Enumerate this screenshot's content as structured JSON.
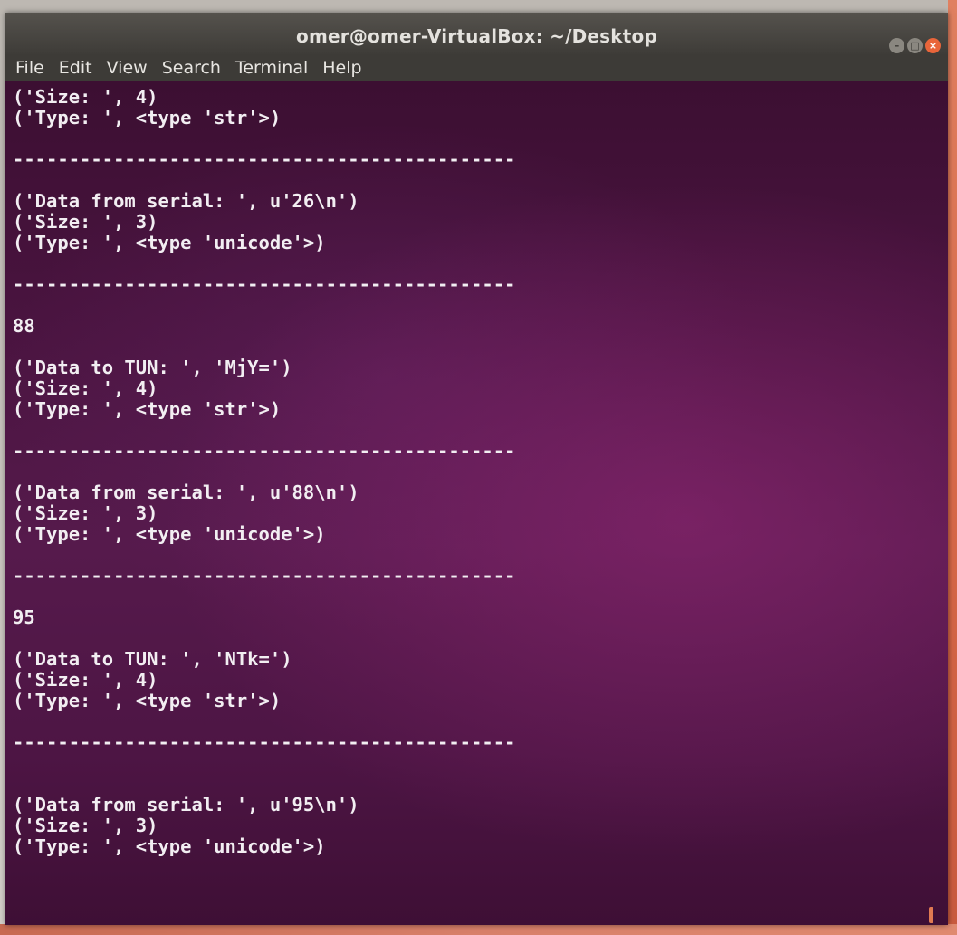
{
  "window": {
    "title": "omer@omer-VirtualBox: ~/Desktop",
    "controls": {
      "minimize": "–",
      "maximize": "□",
      "close": "×"
    }
  },
  "menu": [
    "File",
    "Edit",
    "View",
    "Search",
    "Terminal",
    "Help"
  ],
  "terminal": {
    "lines": [
      "('Size: ', 4)",
      "('Type: ', <type 'str'>)",
      "",
      "---------------------------------------------",
      "",
      "('Data from serial: ', u'26\\n')",
      "('Size: ', 3)",
      "('Type: ', <type 'unicode'>)",
      "",
      "---------------------------------------------",
      "",
      "88",
      "",
      "('Data to TUN: ', 'MjY=')",
      "('Size: ', 4)",
      "('Type: ', <type 'str'>)",
      "",
      "---------------------------------------------",
      "",
      "('Data from serial: ', u'88\\n')",
      "('Size: ', 3)",
      "('Type: ', <type 'unicode'>)",
      "",
      "---------------------------------------------",
      "",
      "95",
      "",
      "('Data to TUN: ', 'NTk=')",
      "('Size: ', 4)",
      "('Type: ', <type 'str'>)",
      "",
      "---------------------------------------------",
      "",
      "",
      "('Data from serial: ', u'95\\n')",
      "('Size: ', 3)",
      "('Type: ', <type 'unicode'>)"
    ]
  },
  "colors": {
    "terminal_bg": "#4a1440",
    "titlebar_bg": "#3e3c38",
    "close_button": "#e9653a",
    "text": "#f2eef2"
  }
}
